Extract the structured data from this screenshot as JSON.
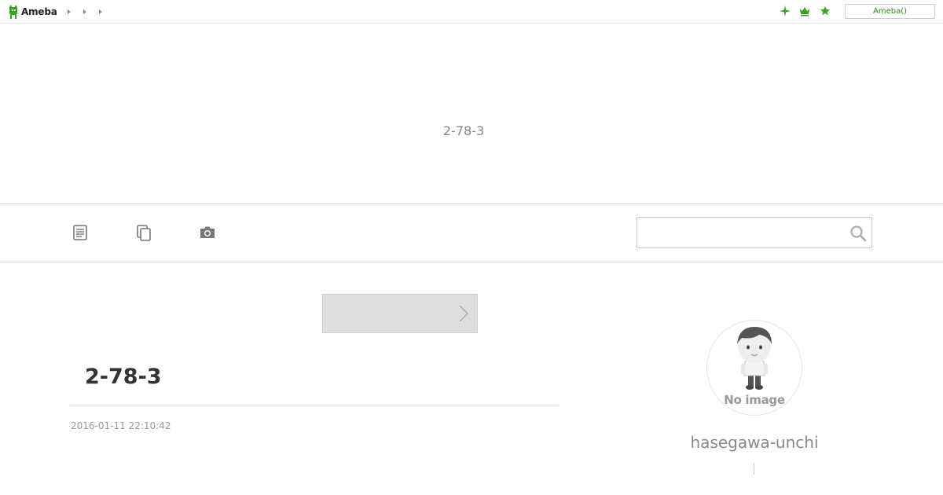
{
  "topbar": {
    "logo_text": "Ameba",
    "breadcrumb_count": 3,
    "icons": [
      "sparkle-icon",
      "crown-icon",
      "star-icon"
    ],
    "account_button_label": "Ameba()",
    "accent_color": "#3aa226"
  },
  "header": {
    "blog_title": "2-78-3"
  },
  "nav": {
    "items": [
      "entries-icon",
      "copy-icon",
      "camera-icon"
    ],
    "search": {
      "value": "",
      "placeholder": ""
    }
  },
  "main": {
    "promo_chevron": "chevron-right-icon",
    "entry": {
      "title": "2-78-3",
      "date": "2016-01-11 22:10:42"
    }
  },
  "sidebar": {
    "avatar_label": "No image",
    "profile_name": "hasegawa-unchi"
  }
}
